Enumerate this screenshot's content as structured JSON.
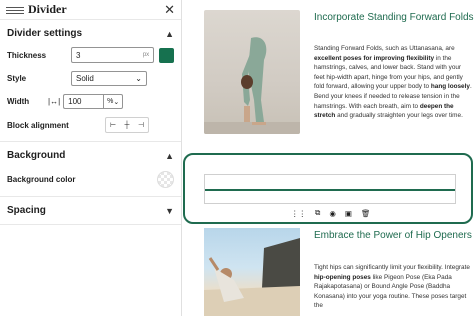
{
  "sidebar": {
    "title": "Divider",
    "settings_title": "Divider settings",
    "thickness": {
      "label": "Thickness",
      "value": "3",
      "unit": "px",
      "color": "#16714f"
    },
    "style": {
      "label": "Style",
      "value": "Solid"
    },
    "width": {
      "label": "Width",
      "value": "100",
      "unit": "%"
    },
    "alignment": {
      "label": "Block alignment"
    },
    "background_title": "Background",
    "background_color_label": "Background color",
    "spacing_title": "Spacing"
  },
  "content": {
    "section1": {
      "heading": "Incorporate Standing Forward Folds",
      "body": [
        "Standing Forward Folds, such as Uttanasana, are ",
        "excellent poses for improving flexibility",
        " in the hamstrings, calves, and lower back. Stand with your feet hip-width apart, hinge from your hips, and gently fold forward, allowing your upper body to ",
        "hang loosely",
        ". Bend your knees if needed to release tension in the hamstrings. With each breath, aim to ",
        "deepen the stretch",
        " and gradually straighten your legs over time."
      ]
    },
    "section2": {
      "heading": "Embrace the Power of Hip Openers",
      "body": [
        "Tight hips can significantly limit your flexibility. Integrate ",
        "hip-opening poses",
        " like Pigeon Pose (Eka Pada Rajakapotasana) or Bound Angle Pose (Baddha Konasana) into your yoga routine. These poses target the"
      ]
    }
  },
  "colors": {
    "accent": "#1f6b4f"
  }
}
